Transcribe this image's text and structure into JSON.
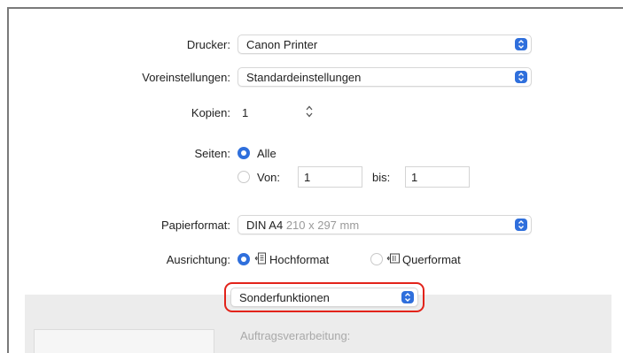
{
  "printer": {
    "label": "Drucker:",
    "value": "Canon Printer"
  },
  "presets": {
    "label": "Voreinstellungen:",
    "value": "Standardeinstellungen"
  },
  "copies": {
    "label": "Kopien:",
    "value": "1"
  },
  "pages": {
    "label": "Seiten:",
    "all_label": "Alle",
    "from_label": "Von:",
    "from_value": "1",
    "to_label": "bis:",
    "to_value": "1",
    "selected": "Alle"
  },
  "paper": {
    "label": "Papierformat:",
    "value": "DIN A4",
    "size": "210 x 297 mm"
  },
  "orientation": {
    "label": "Ausrichtung:",
    "portrait_label": "Hochformat",
    "landscape_label": "Querformat",
    "selected": "Hochformat"
  },
  "section_menu": {
    "value": "Sonderfunktionen"
  },
  "job_processing": {
    "label": "Auftragsverarbeitung:"
  },
  "colors": {
    "accent": "#2f6fdc",
    "highlight": "#e2231a"
  }
}
